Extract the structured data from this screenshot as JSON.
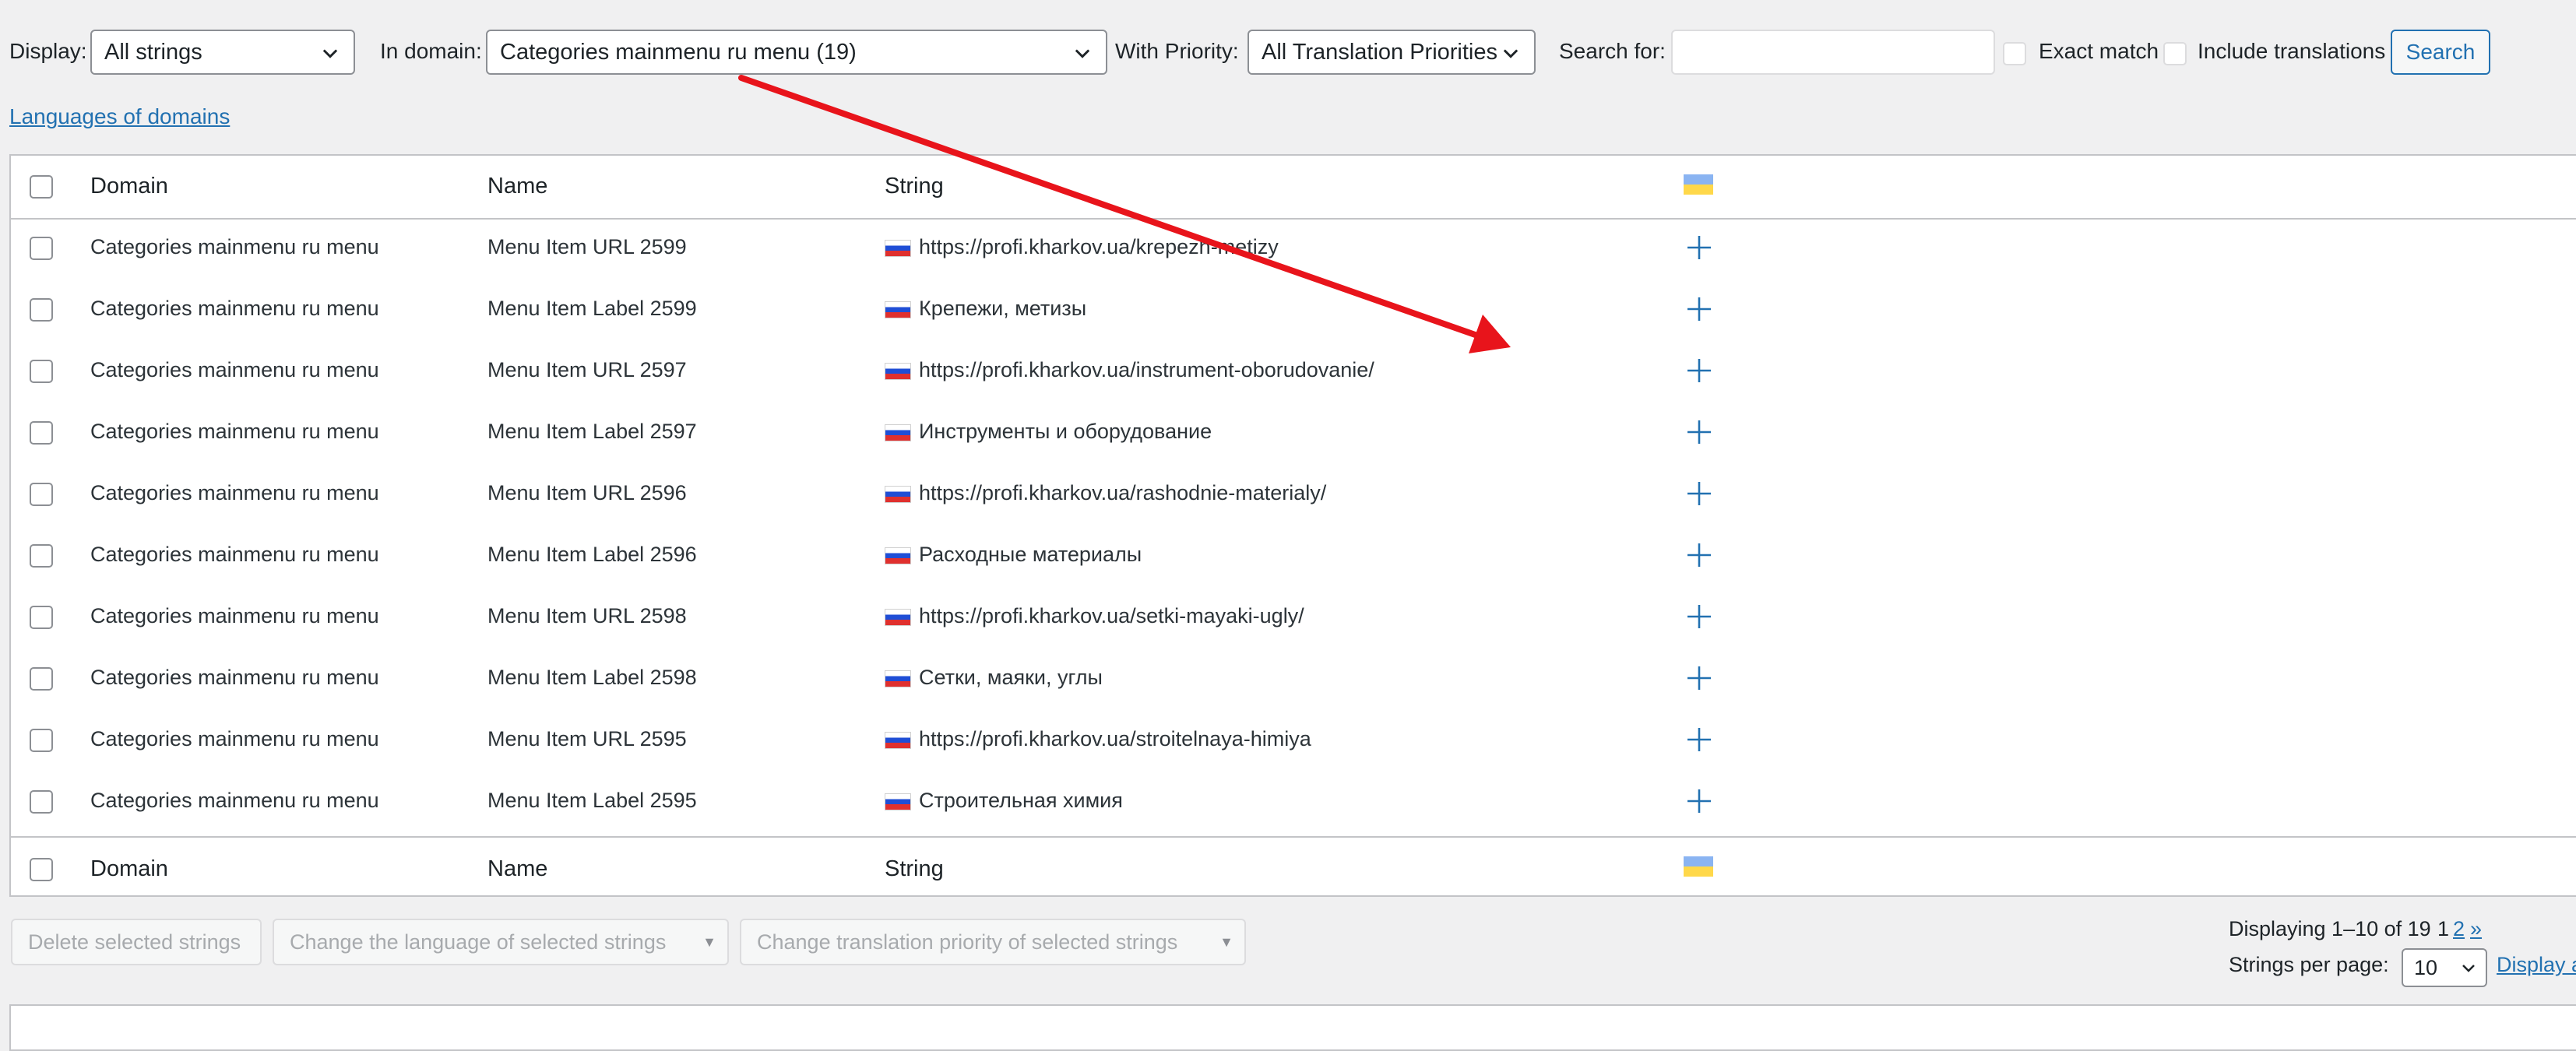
{
  "filters": {
    "display_label": "Display:",
    "display_value": "All strings",
    "domain_label": "In domain:",
    "domain_value": "Categories mainmenu ru menu (19)",
    "priority_label": "With Priority:",
    "priority_value": "All Translation Priorities",
    "search_label": "Search for:",
    "search_value": "",
    "exact_match_label": "Exact match",
    "include_translations_label": "Include translations",
    "search_button": "Search"
  },
  "languages_link": "Languages of domains",
  "table": {
    "columns": {
      "domain": "Domain",
      "name": "Name",
      "string": "String"
    },
    "target_language_flag": "ukraine-flag",
    "source_language_flag": "russia-flag",
    "rows": [
      {
        "domain": "Categories mainmenu ru menu",
        "name": "Menu Item URL 2599",
        "string": "https://profi.kharkov.ua/krepezh-metizy"
      },
      {
        "domain": "Categories mainmenu ru menu",
        "name": "Menu Item Label 2599",
        "string": "Крепежи, метизы"
      },
      {
        "domain": "Categories mainmenu ru menu",
        "name": "Menu Item URL 2597",
        "string": "https://profi.kharkov.ua/instrument-oborudovanie/"
      },
      {
        "domain": "Categories mainmenu ru menu",
        "name": "Menu Item Label 2597",
        "string": "Инструменты и оборудование"
      },
      {
        "domain": "Categories mainmenu ru menu",
        "name": "Menu Item URL 2596",
        "string": "https://profi.kharkov.ua/rashodnie-materialy/"
      },
      {
        "domain": "Categories mainmenu ru menu",
        "name": "Menu Item Label 2596",
        "string": "Расходные материалы"
      },
      {
        "domain": "Categories mainmenu ru menu",
        "name": "Menu Item URL 2598",
        "string": "https://profi.kharkov.ua/setki-mayaki-ugly/"
      },
      {
        "domain": "Categories mainmenu ru menu",
        "name": "Menu Item Label 2598",
        "string": "Сетки, маяки, углы"
      },
      {
        "domain": "Categories mainmenu ru menu",
        "name": "Menu Item URL 2595",
        "string": "https://profi.kharkov.ua/stroitelnaya-himiya"
      },
      {
        "domain": "Categories mainmenu ru menu",
        "name": "Menu Item Label 2595",
        "string": "Строительная химия"
      }
    ]
  },
  "bulk_actions": {
    "delete": "Delete selected strings",
    "change_language": "Change the language of selected strings",
    "change_priority": "Change translation priority of selected strings"
  },
  "pagination": {
    "displaying": "Displaying 1–10 of 19",
    "current_page": "1",
    "next_page": "2",
    "next_arrow": "»",
    "per_page_label": "Strings per page:",
    "per_page_value": "10",
    "display_all": "Display a"
  },
  "colors": {
    "accent": "#2271b1",
    "annotation_arrow": "#e8141b",
    "background": "#f0f0f1"
  }
}
